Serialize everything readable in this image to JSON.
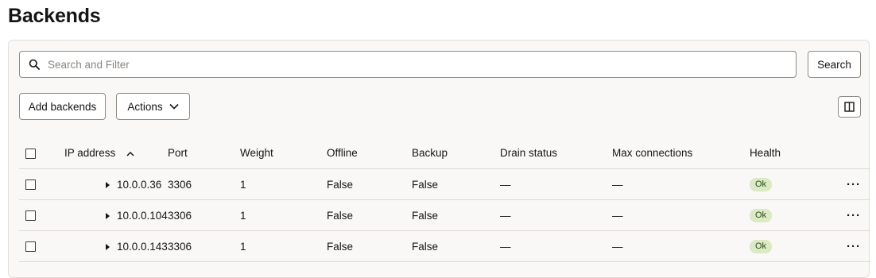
{
  "page": {
    "title": "Backends"
  },
  "search": {
    "placeholder": "Search and Filter",
    "value": "",
    "button_label": "Search"
  },
  "toolbar": {
    "add_label": "Add backends",
    "actions_label": "Actions"
  },
  "table": {
    "columns": [
      "IP address",
      "Port",
      "Weight",
      "Offline",
      "Backup",
      "Drain status",
      "Max connections",
      "Health"
    ],
    "rows": [
      {
        "ip": "10.0.0.36",
        "port": "3306",
        "weight": "1",
        "offline": "False",
        "backup": "False",
        "drain": "—",
        "max_conn": "—",
        "health": "Ok"
      },
      {
        "ip": "10.0.0.104",
        "port": "3306",
        "weight": "1",
        "offline": "False",
        "backup": "False",
        "drain": "—",
        "max_conn": "—",
        "health": "Ok"
      },
      {
        "ip": "10.0.0.143",
        "port": "3306",
        "weight": "1",
        "offline": "False",
        "backup": "False",
        "drain": "—",
        "max_conn": "—",
        "health": "Ok"
      }
    ]
  },
  "colors": {
    "health_ok_bg": "#d9eac4",
    "panel_bg": "#f9f8f6",
    "border": "#8d8a86"
  }
}
